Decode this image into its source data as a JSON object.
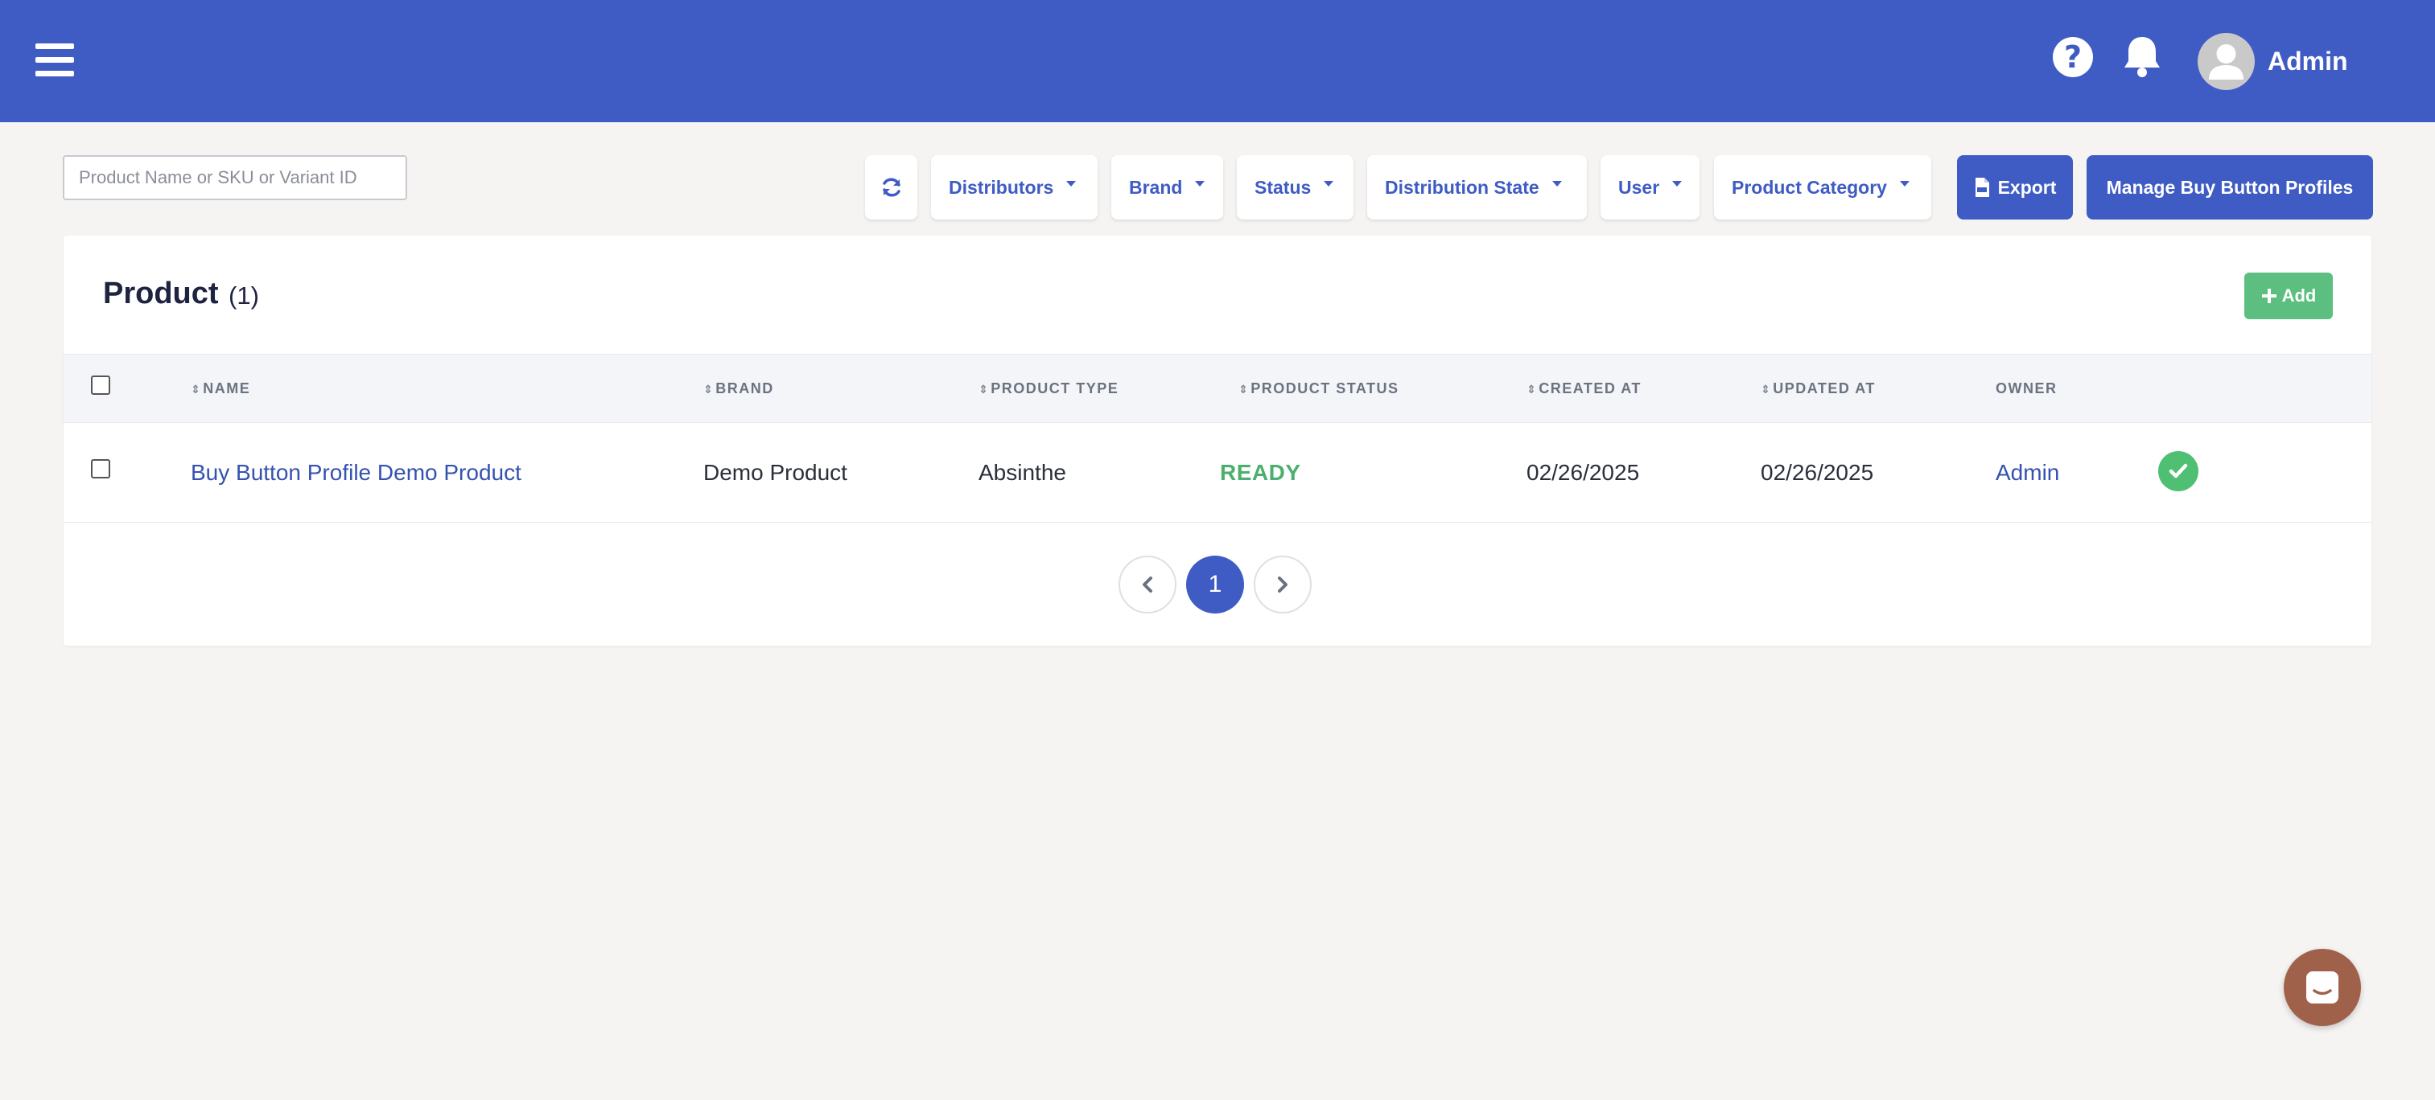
{
  "header": {
    "user_name": "Admin",
    "help_glyph": "?",
    "icons": [
      "menu-icon",
      "help-icon",
      "bell-icon",
      "user-avatar"
    ]
  },
  "toolbar": {
    "search_placeholder": "Product Name or SKU or Variant ID",
    "search_value": "",
    "filters": [
      "Distributors",
      "Brand",
      "Status",
      "Distribution State",
      "User",
      "Product Category"
    ],
    "export_label": "Export",
    "manage_label": "Manage Buy Button Profiles"
  },
  "card": {
    "title": "Product",
    "count": "(1)",
    "add_label": "Add"
  },
  "table": {
    "columns": [
      "NAME",
      "BRAND",
      "PRODUCT TYPE",
      "PRODUCT STATUS",
      "CREATED AT",
      "UPDATED AT",
      "OWNER"
    ],
    "rows": [
      {
        "name": "Buy Button Profile Demo Product",
        "brand": "Demo Product",
        "product_type": "Absinthe",
        "status": "READY",
        "created_at": "02/26/2025",
        "updated_at": "02/26/2025",
        "owner": "Admin"
      }
    ]
  },
  "pagination": {
    "current_page": "1"
  },
  "colors": {
    "primary": "#3f5bc4",
    "success": "#5cbf7f",
    "ready": "#4caf6e",
    "chat": "#a0614b",
    "background": "#f5f4f2"
  }
}
